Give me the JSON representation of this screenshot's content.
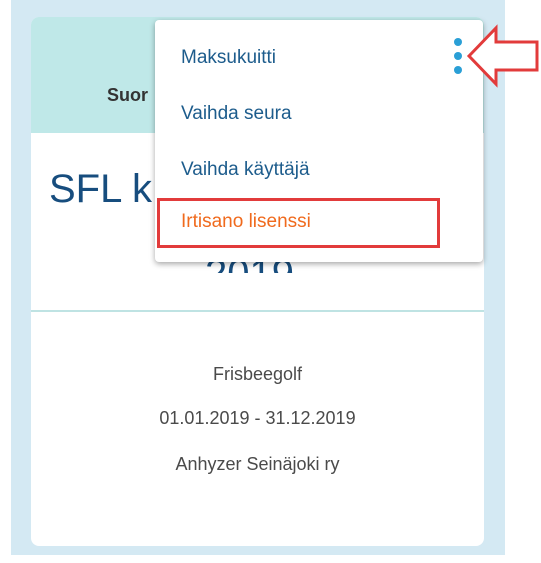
{
  "card": {
    "header_label": "Suor",
    "title": "SFL k",
    "year": "2019",
    "details": [
      "Frisbeegolf",
      "01.01.2019 - 31.12.2019",
      "Anhyzer Seinäjoki ry"
    ]
  },
  "menu": {
    "items": [
      "Maksukuitti",
      "Vaihda seura",
      "Vaihda käyttäjä",
      "Irtisano lisenssi"
    ]
  },
  "colors": {
    "card_header": "#bfe8e8",
    "outer_bg": "#d4e9f3",
    "menu_text": "#1d5c8c",
    "destructive_text": "#f06a1d",
    "highlight": "#e23b3b",
    "kebab": "#2a9fd6"
  },
  "icons": {
    "kebab": "more-vertical-icon",
    "annotation_arrow": "left-arrow-icon"
  }
}
